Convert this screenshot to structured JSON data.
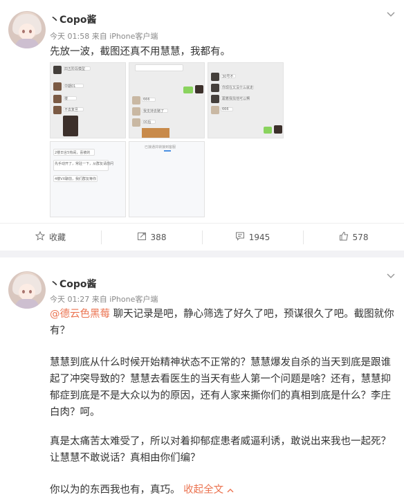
{
  "post1": {
    "username": "丶Copo酱",
    "time": "今天 01:58",
    "from_prefix": "来自",
    "source": "iPhone客户端",
    "text": "先放一波，截图还真不用慧慧，我都有。",
    "images_count": 6
  },
  "actions": {
    "favorite": "收藏",
    "repost": "388",
    "comment": "1945",
    "like": "578"
  },
  "post2": {
    "username": "丶Copo酱",
    "time": "今天 01:27",
    "from_prefix": "来自",
    "source": "iPhone客户端",
    "mention": "@德云色黑莓",
    "para1_rest": " 聊天记录是吧，静心筛选了好久了吧，预谋很久了吧。截图就你有？",
    "para2": "慧慧到底从什么时候开始精神状态不正常的？慧慧爆发自杀的当天到底是跟谁起了冲突导致的？慧慧去看医生的当天有些人第一个问题是啥？还有，慧慧抑郁症到底是不是大众以为的原因，还有人家来撕你们的真相到底是什么？李庄白肉？呵。",
    "para3": "真是太痛苦太难受了，所以对着抑郁症患者威逼利诱，敢说出来我也一起死？让慧慧不敢说话？真相由你们编？",
    "para4": "你以为的东西我也有，真巧。",
    "collapse_label": "收起全文"
  },
  "icons": {
    "chevron": "chevron-down-icon",
    "favorite": "star-icon",
    "repost": "repost-icon",
    "comment": "comment-icon",
    "like": "thumbs-up-icon"
  },
  "thumb_text": {
    "a1": "四五阶段模型",
    "a2": "中期01",
    "a3": "楼",
    "a4": "不去复旦",
    "b1": "666",
    "b2": "我支持去赌了",
    "b3": "00后",
    "c1": "你可以吧，你们又怎么样了",
    "c2": "30号不",
    "c3": "你现在又没什么就走",
    "c4": "跟着我找他可以啊",
    "c5": "666",
    "d1": "2楼日言5热闹，喜被的",
    "d2": "先手动开了，常驻一下，从群友请前问",
    "d3": "4楼VX聊前，我们群友等你",
    "e1": "已接通并转接到客服"
  },
  "colors": {
    "accent": "#eb7350",
    "text": "#333333",
    "meta": "#888888"
  }
}
